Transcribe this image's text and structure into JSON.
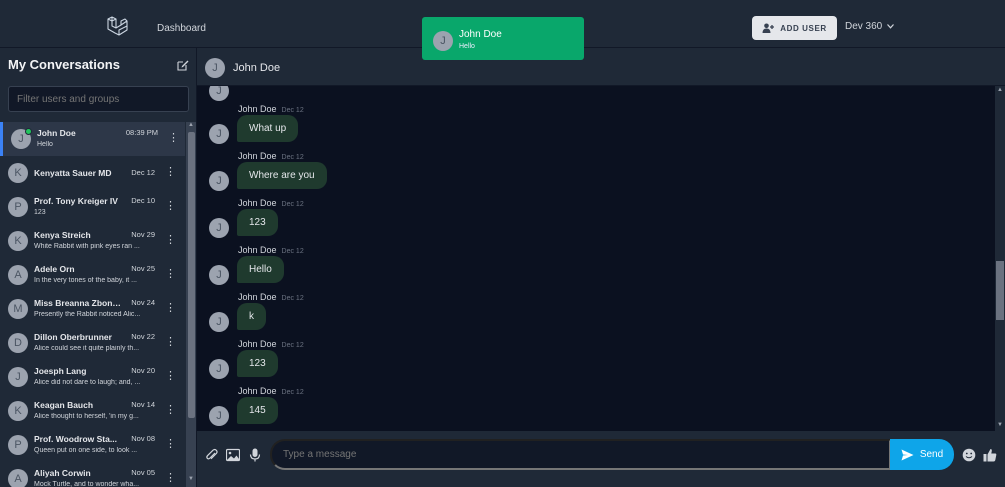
{
  "topbar": {
    "nav_dashboard": "Dashboard",
    "add_user_label": "ADD USER",
    "user_name": "Dev 360"
  },
  "toast": {
    "avatar": "J",
    "name": "John Doe",
    "message": "Hello"
  },
  "sidebar": {
    "title": "My Conversations",
    "filter_placeholder": "Filter users and groups",
    "conversations": [
      {
        "initial": "J",
        "name": "John Doe",
        "time": "08:39 PM",
        "preview": "Hello",
        "online": true,
        "selected": true
      },
      {
        "initial": "K",
        "name": "Kenyatta Sauer MD",
        "time": "Dec 12",
        "preview": ""
      },
      {
        "initial": "P",
        "name": "Prof. Tony Kreiger IV",
        "time": "Dec 10",
        "preview": "123"
      },
      {
        "initial": "K",
        "name": "Kenya Streich",
        "time": "Nov 29",
        "preview": "White Rabbit with pink eyes ran ..."
      },
      {
        "initial": "A",
        "name": "Adele Orn",
        "time": "Nov 25",
        "preview": "In the very tones of the baby, it ..."
      },
      {
        "initial": "M",
        "name": "Miss Breanna Zbonc...",
        "time": "Nov 24",
        "preview": "Presently the Rabbit noticed Alic..."
      },
      {
        "initial": "D",
        "name": "Dillon Oberbrunner",
        "time": "Nov 22",
        "preview": "Alice could see it quite plainly th..."
      },
      {
        "initial": "J",
        "name": "Joesph Lang",
        "time": "Nov 20",
        "preview": "Alice did not dare to laugh; and, ..."
      },
      {
        "initial": "K",
        "name": "Keagan Bauch",
        "time": "Nov 14",
        "preview": "Alice thought to herself, 'in my g..."
      },
      {
        "initial": "P",
        "name": "Prof. Woodrow Sta...",
        "time": "Nov 08",
        "preview": "Queen put on one side, to look ..."
      },
      {
        "initial": "A",
        "name": "Aliyah Corwin",
        "time": "Nov 05",
        "preview": "Mock Turtle, and to wonder wha..."
      }
    ]
  },
  "chat": {
    "header_avatar": "J",
    "header_name": "John Doe",
    "messages": [
      {
        "avatar": "J",
        "sender": "John Doe",
        "date": "Dec 12",
        "text": "What up"
      },
      {
        "avatar": "J",
        "sender": "John Doe",
        "date": "Dec 12",
        "text": "Where are you"
      },
      {
        "avatar": "J",
        "sender": "John Doe",
        "date": "Dec 12",
        "text": "123"
      },
      {
        "avatar": "J",
        "sender": "John Doe",
        "date": "Dec 12",
        "text": "Hello"
      },
      {
        "avatar": "J",
        "sender": "John Doe",
        "date": "Dec 12",
        "text": "k"
      },
      {
        "avatar": "J",
        "sender": "John Doe",
        "date": "Dec 12",
        "text": "123"
      },
      {
        "avatar": "J",
        "sender": "John Doe",
        "date": "Dec 12",
        "text": "145"
      }
    ]
  },
  "composer": {
    "placeholder": "Type a message",
    "send_label": "Send",
    "icons": [
      "attachment-icon",
      "image-icon",
      "microphone-icon",
      "emoji-icon",
      "thumbs-up-icon"
    ]
  },
  "colors": {
    "toast": "#09a76b",
    "send": "#0ea5e9",
    "bubble": "#1f3a2e",
    "online": "#22c55e",
    "selected_border": "#3b82f6"
  }
}
